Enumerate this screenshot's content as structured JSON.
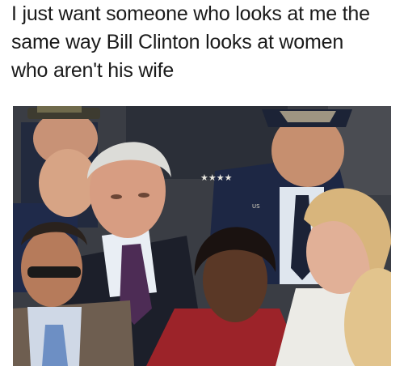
{
  "caption": {
    "lines": [
      "I just want someone who looks at me the",
      "same way Bill Clinton looks at women",
      "who aren't his wife"
    ]
  },
  "photo": {
    "uniform_badge_text": "US",
    "colors": {
      "background_crowd": "#3a3d44",
      "navy_uniform": "#1d2744",
      "clinton_hair": "#dcdcd8",
      "red_coat": "#9c2329",
      "white_coat": "#ecebe6",
      "blonde_hair": "#d8b57c",
      "skin_light": "#d6a182",
      "skin_dark": "#5a3826"
    }
  }
}
